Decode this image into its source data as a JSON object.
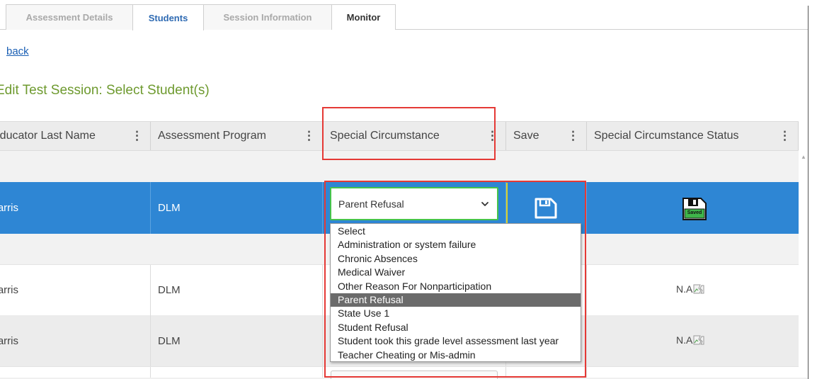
{
  "tabs": [
    {
      "label": "Assessment Details",
      "active": false
    },
    {
      "label": "Students",
      "active": true
    },
    {
      "label": "Session Information",
      "active": false
    },
    {
      "label": "Monitor",
      "active": false
    }
  ],
  "back_link": "back",
  "page_title": "Edit Test Session: Select Student(s)",
  "columns": [
    {
      "label": "Educator Last Name"
    },
    {
      "label": "Assessment Program"
    },
    {
      "label": "Special Circumstance"
    },
    {
      "label": "Save"
    },
    {
      "label": "Special Circumstance Status"
    }
  ],
  "menu_glyph": "⋮",
  "rows": [
    {
      "educator": "Harris",
      "program": "DLM",
      "status": ""
    },
    {
      "educator": "Harris",
      "program": "DLM",
      "status": "N.A"
    },
    {
      "educator": "Harris",
      "program": "DLM",
      "status": "N.A"
    }
  ],
  "special_circumstance": {
    "selected": "Parent Refusal",
    "options": [
      "Select",
      "Administration or system failure",
      "Chronic Absences",
      "Medical Waiver",
      "Other Reason For Nonparticipation",
      "Parent Refusal",
      "State Use 1",
      "Student Refusal",
      "Student took this grade level assessment last year",
      "Teacher Cheating or Mis-admin"
    ]
  },
  "saved_icon_label": "Saved",
  "icons": {
    "save": "floppy-disk-icon",
    "saved": "saved-floppy-icon",
    "dropdown": "chevron-down-icon",
    "column_menu": "vertical-ellipsis-icon",
    "missing_image": "broken-image-icon"
  },
  "colors": {
    "selected_row": "#2e86d4",
    "title_green": "#6e9a2f",
    "link_blue": "#1a5fb4",
    "highlight_red": "#e53935",
    "focus_green": "#46c44b",
    "selected_option": "#6b6b6b"
  }
}
